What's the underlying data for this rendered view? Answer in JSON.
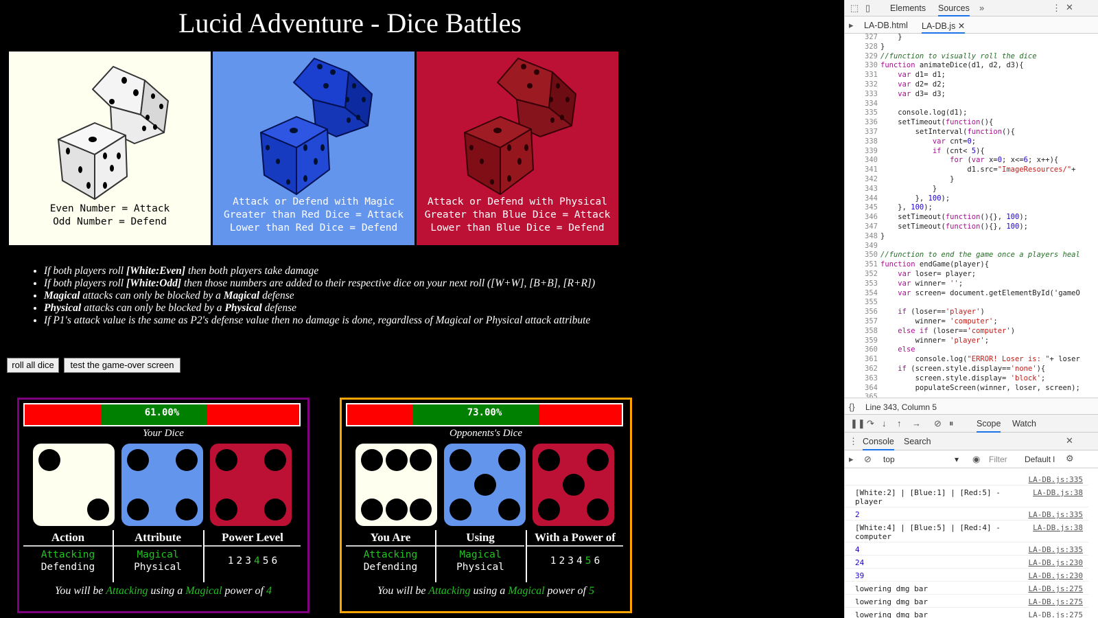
{
  "game": {
    "title": "Lucid Adventure - Dice Battles",
    "panels": [
      {
        "color": "white",
        "lines": [
          "Even Number = Attack",
          "Odd Number = Defend"
        ]
      },
      {
        "color": "blue",
        "lines": [
          "Attack or Defend with Magic",
          "Greater than Red Dice = Attack",
          "Lower than Red Dice = Defend"
        ]
      },
      {
        "color": "red",
        "lines": [
          "Attack or Defend with Physical",
          "Greater than Blue Dice = Attack",
          "Lower than Blue Dice = Defend"
        ]
      }
    ],
    "rules": [
      {
        "a": "If both players roll ",
        "b": "[White:Even]",
        "c": " then both players take damage"
      },
      {
        "a": "If both players roll ",
        "b": "[White:Odd]",
        "c": " then those numbers are added to their respective dice on your next roll ([W+W], [B+B], [R+R])"
      },
      {
        "a": "",
        "b": "Magical",
        "c": " attacks can only be blocked by a ",
        "d": "Magical",
        "e": " defense"
      },
      {
        "a": "",
        "b": "Physical",
        "c": " attacks can only be blocked by a ",
        "d": "Physical",
        "e": " defense"
      },
      {
        "a": "If P1's attack value is the same as P2's defense value then no damage is done, regardless of Magical or Physical attack attribute"
      }
    ],
    "buttons": {
      "roll": "roll all dice",
      "test": "test the game-over screen"
    },
    "player": {
      "health_text": "61.00%",
      "health": 61,
      "dice_caption": "Your Dice",
      "dice": {
        "white": 2,
        "blue": 4,
        "red": 4
      },
      "headers": [
        "Action",
        "Attribute",
        "Power Level"
      ],
      "action_options": [
        "Attacking",
        "Defending"
      ],
      "attribute_options": [
        "Magical",
        "Physical"
      ],
      "levels": [
        "1",
        "2",
        "3",
        "4",
        "5",
        "6"
      ],
      "active_level": 4,
      "summary": {
        "pre": "You will be ",
        "action": "Attacking",
        "mid": " using a ",
        "attr": "Magical",
        "post": " power of ",
        "power": "4"
      }
    },
    "opponent": {
      "health_text": "73.00%",
      "health": 73,
      "dice_caption": "Opponents's Dice",
      "dice": {
        "white": 6,
        "blue": 5,
        "red": 5
      },
      "headers": [
        "You Are",
        "Using",
        "With a Power of"
      ],
      "action_options": [
        "Attacking",
        "Defending"
      ],
      "attribute_options": [
        "Magical",
        "Physical"
      ],
      "levels": [
        "1",
        "2",
        "3",
        "4",
        "5",
        "6"
      ],
      "active_level": 5,
      "summary": {
        "pre": "You will be ",
        "action": "Attacking",
        "mid": " using a ",
        "attr": "Magical",
        "post": " power of ",
        "power": "5"
      }
    },
    "colors": {
      "white_die": "#fffff0",
      "blue_die": "#6495ed",
      "red_die": "#bc1034",
      "health_green": "#008000",
      "health_red": "#ff0000",
      "active_text": "#22c322",
      "player_border": "#800080",
      "opponent_border": "#ffa500"
    }
  },
  "devtools": {
    "tabs": [
      "Elements",
      "Sources"
    ],
    "files": [
      "LA-DB.html",
      "LA-DB.js"
    ],
    "status": "Line 343, Column 5",
    "debug_tabs": [
      "Scope",
      "Watch"
    ],
    "drawer_tabs": [
      "Console",
      "Search"
    ],
    "context": "top",
    "filter": "Filter",
    "levels": "Default l",
    "code_lines": [
      {
        "n": "327",
        "t": "    }"
      },
      {
        "n": "328",
        "t": "}"
      },
      {
        "n": "329",
        "t": "//function to visually roll the dice"
      },
      {
        "n": "330",
        "t": "function animateDice(d1, d2, d3){"
      },
      {
        "n": "331",
        "t": "    var d1= d1;"
      },
      {
        "n": "332",
        "t": "    var d2= d2;"
      },
      {
        "n": "333",
        "t": "    var d3= d3;"
      },
      {
        "n": "334",
        "t": ""
      },
      {
        "n": "335",
        "t": "    console.log(d1);"
      },
      {
        "n": "336",
        "t": "    setTimeout(function(){"
      },
      {
        "n": "337",
        "t": "        setInterval(function(){"
      },
      {
        "n": "338",
        "t": "            var cnt=0;"
      },
      {
        "n": "339",
        "t": "            if (cnt< 5){"
      },
      {
        "n": "340",
        "t": "                for (var x=0; x<=6; x++){"
      },
      {
        "n": "341",
        "t": "                    d1.src=\"ImageResources/\"+"
      },
      {
        "n": "342",
        "t": "                }"
      },
      {
        "n": "343",
        "t": "            }"
      },
      {
        "n": "344",
        "t": "        }, 100);"
      },
      {
        "n": "345",
        "t": "    }, 100);"
      },
      {
        "n": "346",
        "t": "    setTimeout(function(){}, 100);"
      },
      {
        "n": "347",
        "t": "    setTimeout(function(){}, 100);"
      },
      {
        "n": "348",
        "t": "}"
      },
      {
        "n": "349",
        "t": ""
      },
      {
        "n": "350",
        "t": "//function to end the game once a players heal"
      },
      {
        "n": "351",
        "t": "function endGame(player){"
      },
      {
        "n": "352",
        "t": "    var loser= player;"
      },
      {
        "n": "353",
        "t": "    var winner= '';"
      },
      {
        "n": "354",
        "t": "    var screen= document.getElementById('gameO"
      },
      {
        "n": "355",
        "t": ""
      },
      {
        "n": "356",
        "t": "    if (loser=='player')"
      },
      {
        "n": "357",
        "t": "        winner= 'computer';"
      },
      {
        "n": "358",
        "t": "    else if (loser=='computer')"
      },
      {
        "n": "359",
        "t": "        winner= 'player';"
      },
      {
        "n": "360",
        "t": "    else"
      },
      {
        "n": "361",
        "t": "        console.log(\"ERROR! Loser is: \"+ loser"
      },
      {
        "n": "362",
        "t": "    if (screen.style.display=='none'){"
      },
      {
        "n": "363",
        "t": "        screen.style.display= 'block';"
      },
      {
        "n": "364",
        "t": "        populateScreen(winner, loser, screen);"
      },
      {
        "n": "365",
        "t": ""
      }
    ],
    "console_rows": [
      {
        "msg": "",
        "src": "LA-DB.js:335",
        "lines": 1,
        "num": false
      },
      {
        "msg": "[White:2] | [Blue:1] | [Red:5] -\nplayer",
        "src": "LA-DB.js:38",
        "lines": 2,
        "num": false
      },
      {
        "msg": "2",
        "src": "LA-DB.js:335",
        "lines": 1,
        "num": true
      },
      {
        "msg": "[White:4] | [Blue:5] | [Red:4] -\ncomputer",
        "src": "LA-DB.js:38",
        "lines": 2,
        "num": false
      },
      {
        "msg": "4",
        "src": "LA-DB.js:335",
        "lines": 1,
        "num": true
      },
      {
        "msg": "24",
        "src": "LA-DB.js:230",
        "lines": 1,
        "num": true
      },
      {
        "msg": "39",
        "src": "LA-DB.js:230",
        "lines": 1,
        "num": true
      },
      {
        "msg": "lowering dmg bar",
        "src": "LA-DB.js:275",
        "lines": 1,
        "num": false
      },
      {
        "msg": "lowering dmg bar",
        "src": "LA-DB.js:275",
        "lines": 1,
        "num": false
      },
      {
        "msg": "lowering dmg bar",
        "src": "LA-DB.js:275",
        "lines": 1,
        "num": false
      }
    ]
  }
}
